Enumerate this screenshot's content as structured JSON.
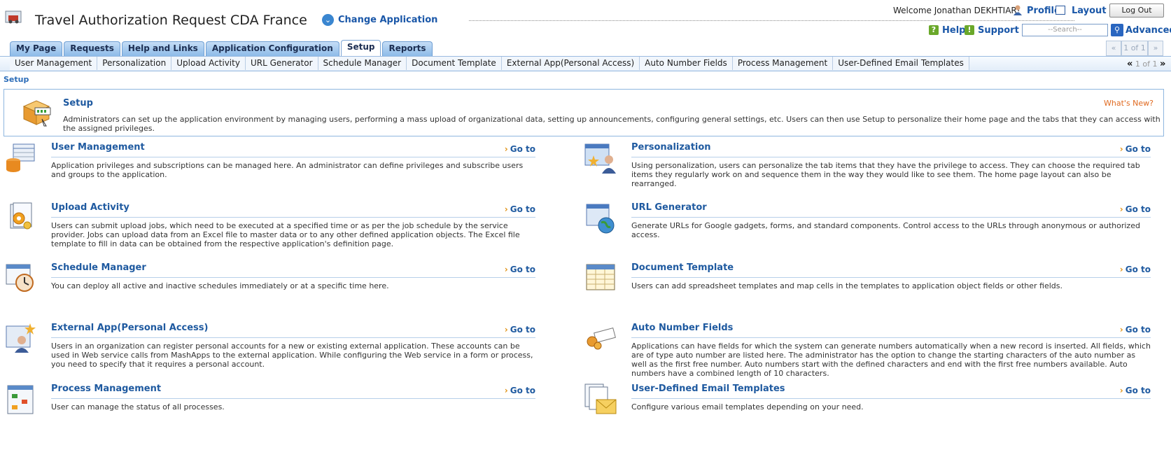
{
  "header": {
    "app_title": "Travel Authorization Request CDA France",
    "change_app_label": "Change Application",
    "welcome_text": "Welcome Jonathan DEKHTIAR!",
    "profile_label": "Profile",
    "layout_label": "Layout",
    "logout_label": "Log Out",
    "help_label": "Help",
    "support_label": "Support",
    "search_placeholder": "--Search--",
    "advanced_label": "Advanced"
  },
  "main_tabs": [
    {
      "label": "My Page"
    },
    {
      "label": "Requests"
    },
    {
      "label": "Help and Links"
    },
    {
      "label": "Application Configuration"
    },
    {
      "label": "Setup",
      "active": true
    },
    {
      "label": "Reports"
    }
  ],
  "main_pager": {
    "prev": "«",
    "text": "1 of 1",
    "next": "»"
  },
  "sub_tabs": [
    {
      "label": "User Management"
    },
    {
      "label": "Personalization"
    },
    {
      "label": "Upload Activity"
    },
    {
      "label": "URL Generator"
    },
    {
      "label": "Schedule Manager"
    },
    {
      "label": "Document Template"
    },
    {
      "label": "External App(Personal Access)"
    },
    {
      "label": "Auto Number Fields"
    },
    {
      "label": "Process Management"
    },
    {
      "label": "User-Defined Email Templates"
    }
  ],
  "sub_pager": {
    "prev": "«",
    "text": "1 of 1",
    "next": "»"
  },
  "breadcrumb": "Setup",
  "setup_panel": {
    "title": "Setup",
    "whats_new": "What's New?",
    "description": "Administrators can set up the application environment by managing users, performing a mass upload of organizational data, setting up announcements, configuring general settings, etc. Users can then use Setup to personalize their home page and the tabs that they can access with the assigned privileges."
  },
  "goto_label": "Go to",
  "items": [
    {
      "title": "User Management",
      "icon": "user-management-icon",
      "description": "Application privileges and subscriptions can be managed here. An administrator can define privileges and subscribe users and groups to the application."
    },
    {
      "title": "Personalization",
      "icon": "personalization-icon",
      "description": "Using personalization, users can personalize the tab items that they have the privilege to access. They can choose the required tab items they regularly work on and sequence them in the way they would like to see them. The home page layout can also be rearranged."
    },
    {
      "title": "Upload Activity",
      "icon": "upload-activity-icon",
      "description": "Users can submit upload jobs, which need to be executed at a specified time or as per the job schedule by the service provider. Jobs can upload data from an Excel file to master data or to any other defined application objects. The Excel file template to fill in data can be obtained from the respective application's definition page."
    },
    {
      "title": "URL Generator",
      "icon": "url-generator-icon",
      "description": "Generate URLs for Google gadgets, forms, and standard components. Control access to the URLs through anonymous or authorized access."
    },
    {
      "title": "Schedule Manager",
      "icon": "schedule-manager-icon",
      "description": "You can deploy all active and inactive schedules immediately or at a specific time here."
    },
    {
      "title": "Document Template",
      "icon": "document-template-icon",
      "description": "Users can add spreadsheet templates and map cells in the templates to application object fields or other fields."
    },
    {
      "title": "External App(Personal Access)",
      "icon": "external-app-icon",
      "description": "Users in an organization can register personal accounts for a new or existing external application. These accounts can be used in Web service calls from MashApps to the external application. While configuring the Web service in a form or process, you need to specify that it requires a personal account."
    },
    {
      "title": "Auto Number Fields",
      "icon": "auto-number-icon",
      "description": "Applications can have fields for which the system can generate numbers automatically when a new record is inserted. All fields, which are of type auto number are listed here. The administrator has the option to change the starting characters of the auto number as well as the first free number. Auto numbers start with the defined characters and end with the first free numbers available. Auto numbers have a combined length of 10 characters."
    },
    {
      "title": "Process Management",
      "icon": "process-management-icon",
      "description": "User can manage the status of all processes."
    },
    {
      "title": "User-Defined Email Templates",
      "icon": "email-templates-icon",
      "description": "Configure various email templates depending on your need."
    }
  ]
}
